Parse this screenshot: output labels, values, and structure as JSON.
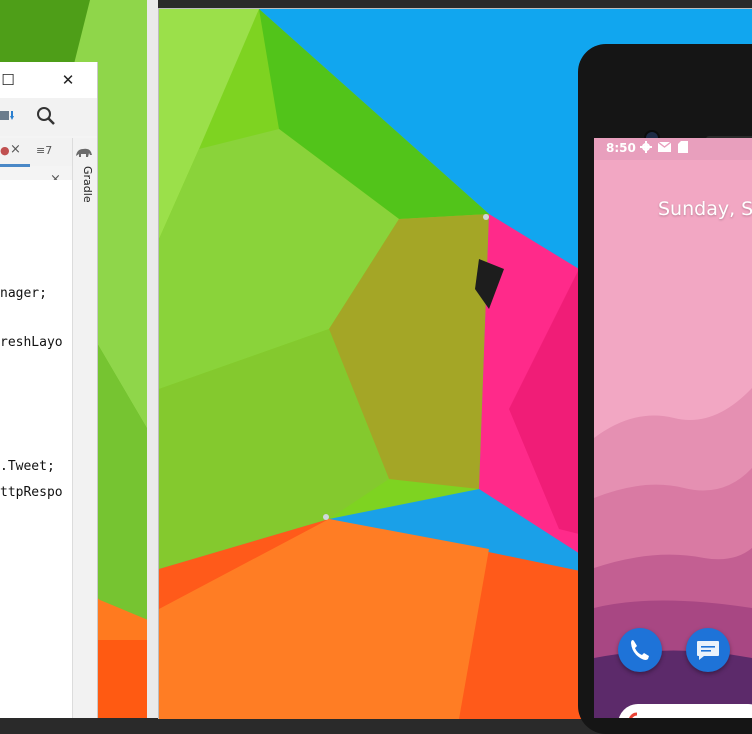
{
  "ide": {
    "title_buttons": {
      "maximize": "☐",
      "close": "✕"
    },
    "toolbar": {
      "search_glyph": "🔍"
    },
    "tabs": {
      "tab_close": "×",
      "list_indicator": "≡7",
      "overflow": "››",
      "overflow_close": "×"
    },
    "side_panel": {
      "gradle_label": "Gradle"
    },
    "status_check": "✔",
    "code_lines": [
      "nager;",
      "reshLayo",
      ".Tweet;",
      "ttpRespo"
    ]
  },
  "phone": {
    "status": {
      "time": "8:50",
      "icons": [
        "gear-icon",
        "mail-icon",
        "sd-card-icon"
      ]
    },
    "date": "Sunday, S",
    "dock": [
      "phone-app-icon",
      "messages-app-icon"
    ]
  },
  "colors": {
    "umbrella_green": "#7ed321",
    "umbrella_blue": "#1aa0e8",
    "umbrella_orange": "#ff5a1a",
    "umbrella_pink": "#ff2a8a",
    "phone_wallpaper_pink": "#f2a7c3",
    "accent_blue": "#4a88c7"
  }
}
